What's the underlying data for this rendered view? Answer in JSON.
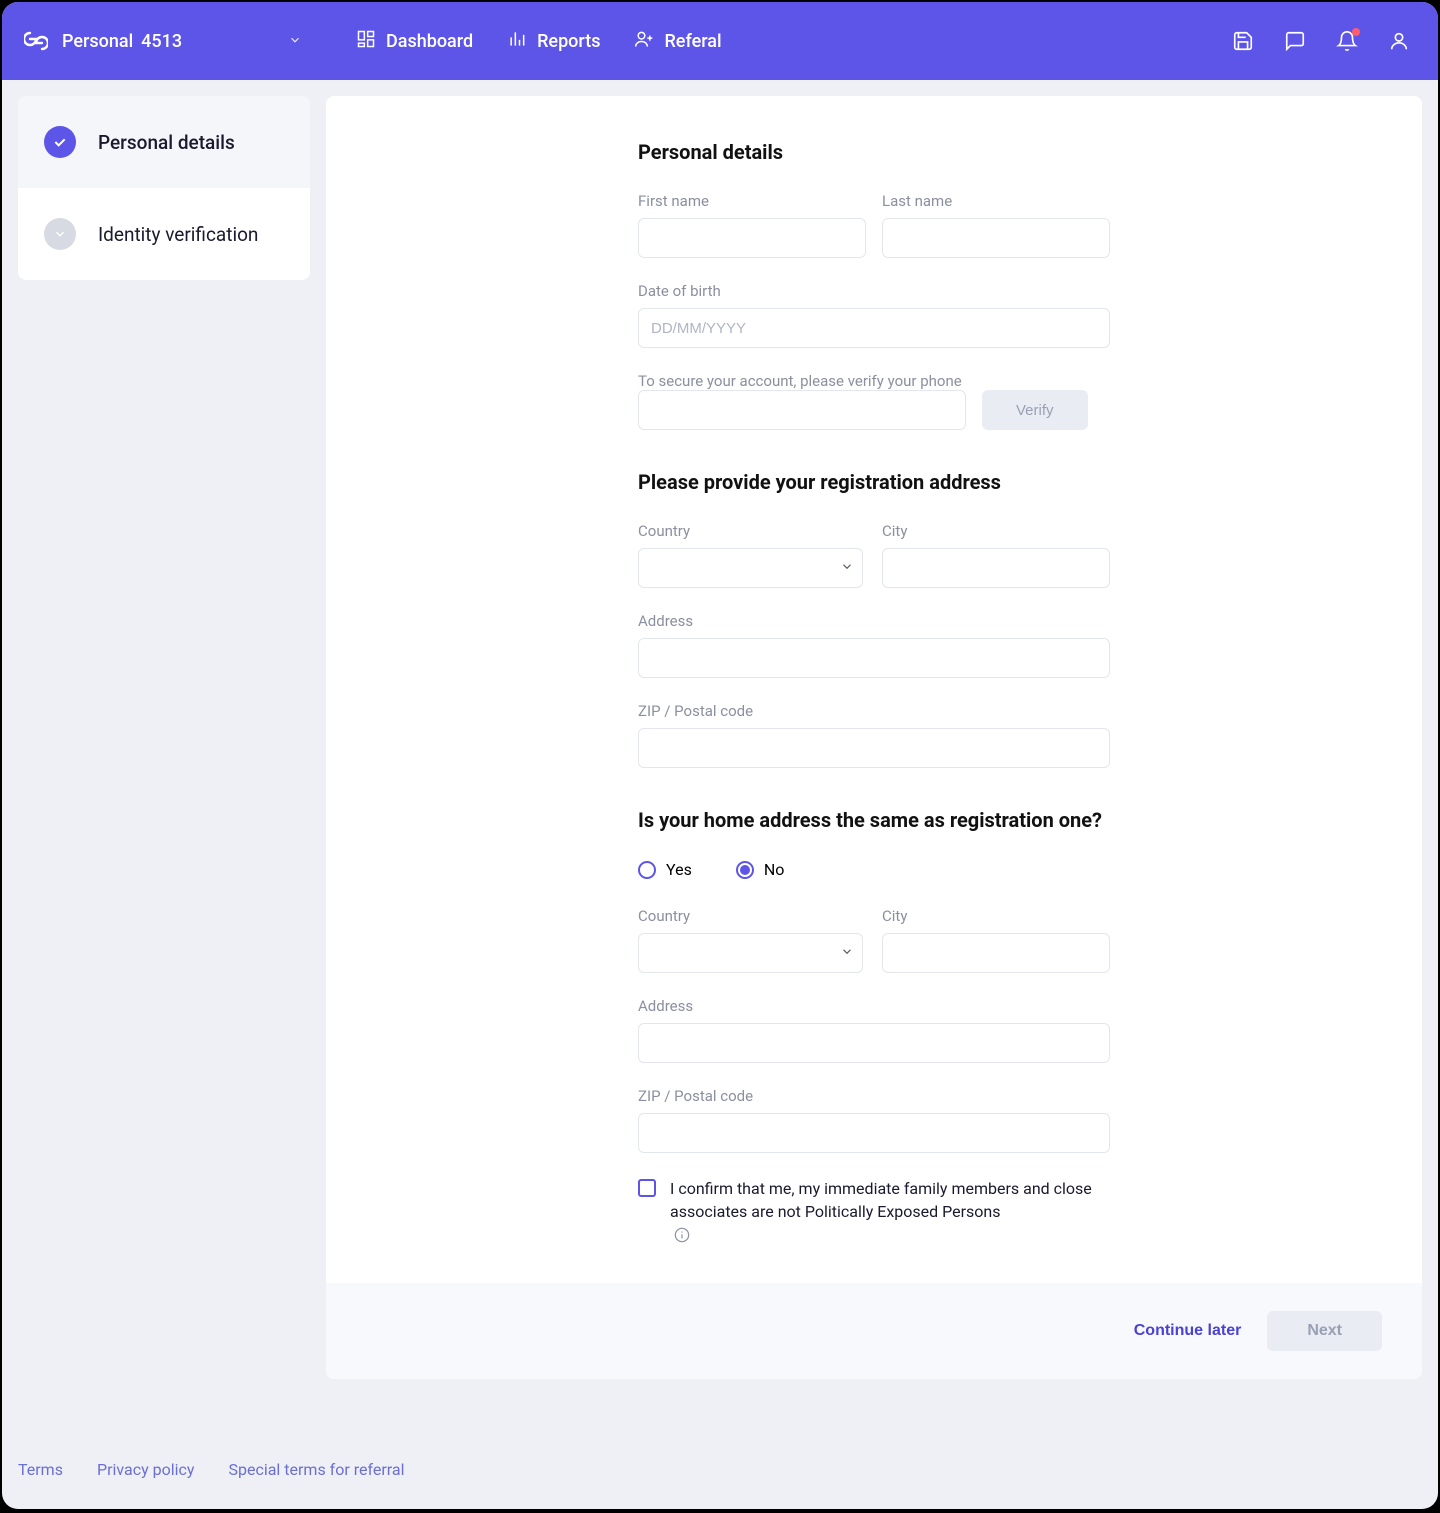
{
  "topbar": {
    "account_label": "Personal",
    "account_number": "4513",
    "nav": [
      {
        "label": "Dashboard"
      },
      {
        "label": "Reports"
      },
      {
        "label": "Referal"
      }
    ]
  },
  "steps": [
    {
      "label": "Personal details",
      "state": "done"
    },
    {
      "label": "Identity verification",
      "state": "pending"
    }
  ],
  "form": {
    "section_personal": "Personal details",
    "first_name_label": "First name",
    "last_name_label": "Last name",
    "dob_label": "Date of birth",
    "dob_placeholder": "DD/MM/YYYY",
    "phone_label": "To secure your account, please verify your phone",
    "verify_btn": "Verify",
    "section_reg_address": "Please provide your registration address",
    "country_label": "Country",
    "city_label": "City",
    "address_label": "Address",
    "zip_label": "ZIP / Postal code",
    "section_home_q": "Is your home address the same as registration one?",
    "radio_yes": "Yes",
    "radio_no": "No",
    "confirm_text": "I confirm that me, my immediate family members and close associates are not Politically Exposed Persons"
  },
  "actions": {
    "continue_later": "Continue later",
    "next": "Next"
  },
  "footer": {
    "terms": "Terms",
    "privacy": "Privacy policy",
    "referral_terms": "Special terms for referral"
  }
}
